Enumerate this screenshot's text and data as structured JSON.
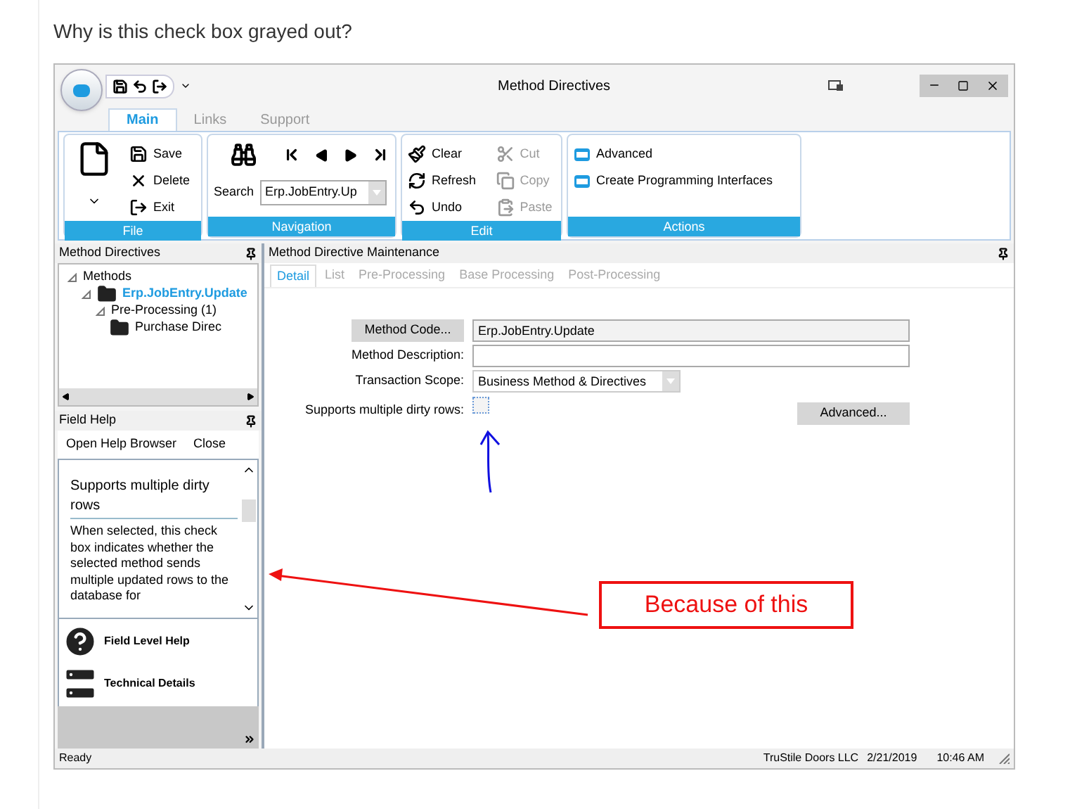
{
  "question": "Why is this check box grayed out?",
  "window": {
    "title": "Method Directives"
  },
  "ribbon_tabs": [
    {
      "label": "Main",
      "selected": true
    },
    {
      "label": "Links",
      "selected": false
    },
    {
      "label": "Support",
      "selected": false
    }
  ],
  "ribbon_groups": [
    {
      "title": "File",
      "kind": "file",
      "items": [
        {
          "label": "Save",
          "kind": "save",
          "disabled": false
        },
        {
          "label": "Delete",
          "kind": "delete",
          "disabled": false
        },
        {
          "label": "Exit",
          "kind": "exit",
          "disabled": false
        }
      ]
    },
    {
      "title": "Navigation",
      "kind": "navigation",
      "search_label": "Search",
      "combo_value": "Erp.JobEntry.Up"
    },
    {
      "title": "Edit",
      "kind": "edit",
      "items": [
        {
          "label": "Clear",
          "kind": "clear",
          "disabled": false
        },
        {
          "label": "Refresh",
          "kind": "refresh",
          "disabled": false
        },
        {
          "label": "Undo",
          "kind": "undo",
          "disabled": false
        },
        {
          "label": "Cut",
          "kind": "cut",
          "disabled": true
        },
        {
          "label": "Copy",
          "kind": "copy",
          "disabled": true
        },
        {
          "label": "Paste",
          "kind": "paste",
          "disabled": true
        }
      ]
    },
    {
      "title": "Actions",
      "kind": "actions",
      "items": [
        {
          "label": "Advanced",
          "kind": "action",
          "disabled": false
        },
        {
          "label": "Create Programming Interfaces",
          "kind": "action",
          "disabled": false
        }
      ]
    }
  ],
  "tree_panel": {
    "title": "Method Directives",
    "tree": [
      {
        "label": "Methods",
        "folder": false,
        "selected": false,
        "expanded": true,
        "children": [
          {
            "label": "Erp.JobEntry.Update",
            "folder": true,
            "selected": true,
            "expanded": true,
            "children": [
              {
                "label": "Pre-Processing (1)",
                "folder": false,
                "selected": false,
                "expanded": true,
                "children": [
                  {
                    "label": "Purchase Direc",
                    "folder": true,
                    "selected": false
                  }
                ]
              }
            ]
          }
        ]
      }
    ]
  },
  "help_panel": {
    "title": "Field Help",
    "links": [
      "Open Help Browser",
      "Close"
    ],
    "heading": "Supports multiple dirty rows",
    "body": "When selected, this check box indicates whether the selected method sends multiple updated rows to the database for",
    "sections": [
      {
        "label": "Field Level Help",
        "kind": "help"
      },
      {
        "label": "Technical Details",
        "kind": "technical"
      }
    ]
  },
  "maintenance": {
    "title": "Method Directive Maintenance",
    "tabs": [
      {
        "label": "Detail",
        "selected": true
      },
      {
        "label": "List",
        "selected": false
      },
      {
        "label": "Pre-Processing",
        "selected": false
      },
      {
        "label": "Base Processing",
        "selected": false
      },
      {
        "label": "Post-Processing",
        "selected": false
      }
    ],
    "method_code_button": "Method Code...",
    "method_code": "Erp.JobEntry.Update",
    "description_label": "Method Description:",
    "scope_label": "Transaction Scope:",
    "scope_value": "Business Method & Directives",
    "dirty_rows_label": "Supports multiple dirty rows:",
    "dirty_rows_checked": false,
    "dirty_rows_disabled": true,
    "advanced_button": "Advanced..."
  },
  "status_bar": {
    "status": "Ready",
    "company": "TruStile Doors LLC",
    "date": "2/21/2019",
    "time": "10:46 AM"
  },
  "annotation": {
    "callout": "Because of this"
  }
}
